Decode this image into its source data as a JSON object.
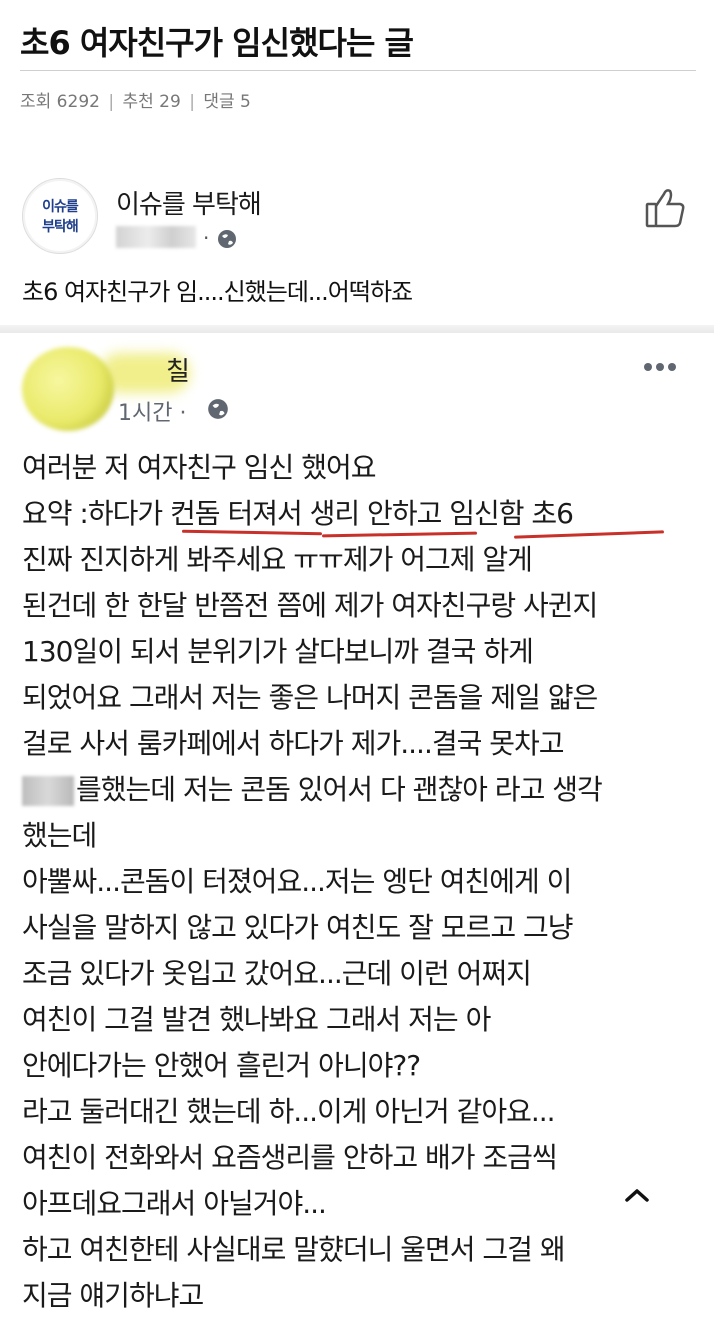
{
  "title": "초6 여자친구가 임신했다는 글",
  "meta": {
    "views": "조회 6292",
    "likes": "추천 29",
    "comments": "댓글 5",
    "sep": "|"
  },
  "fb_card": {
    "avatar_line1": "이슈를",
    "avatar_line2": "부탁해",
    "page_name": "이슈를 부탁해",
    "dot": "·",
    "post_text": "초6 여자친구가 임....신했는데...어떡하죠"
  },
  "post": {
    "author_name": "칠",
    "time": "1시간 ·",
    "lines": [
      "여러분 저 여자친구 임신 했어요",
      "요약 :하다가 컨돔 터져서 생리 안하고 임신함 초6",
      "진짜 진지하게 봐주세요 ㅠㅠ제가 어그제 알게",
      "된건데 한 한달 반쯤전 쯤에 제가 여자친구랑 사귄지",
      "130일이 되서 분위기가 살다보니까 결국 하게",
      "되었어요 그래서 저는 좋은 나머지 콘돔을 제일 얇은",
      "걸로 사서 룸카페에서 하다가 제가....결국 못차고",
      "를했는데 저는 콘돔 있어서 다 괜찮아 라고 생각",
      "했는데",
      "아뿔싸...콘돔이 터졌어요...저는 엥단 여친에게 이",
      "사실을 말하지 않고 있다가 여친도 잘 모르고 그냥",
      "조금 있다가 옷입고 갔어요...근데 이런 어쩌지",
      "여친이 그걸 발견 했나봐요 그래서 저는 아",
      "안에다가는 안했어 흘린거 아니야??",
      "라고 둘러대긴 했는데 하...이게 아닌거 같아요...",
      "여친이 전화와서 요즘생리를 안하고 배가 조금씩",
      "아프데요그래서 아닐거야...",
      "하고 여친한테 사실대로 말햤더니 울면서 그걸 왜",
      "지금 얘기하냐고"
    ]
  },
  "colors": {
    "underline": "#c8302a",
    "link_blue": "#1f3f8c"
  }
}
